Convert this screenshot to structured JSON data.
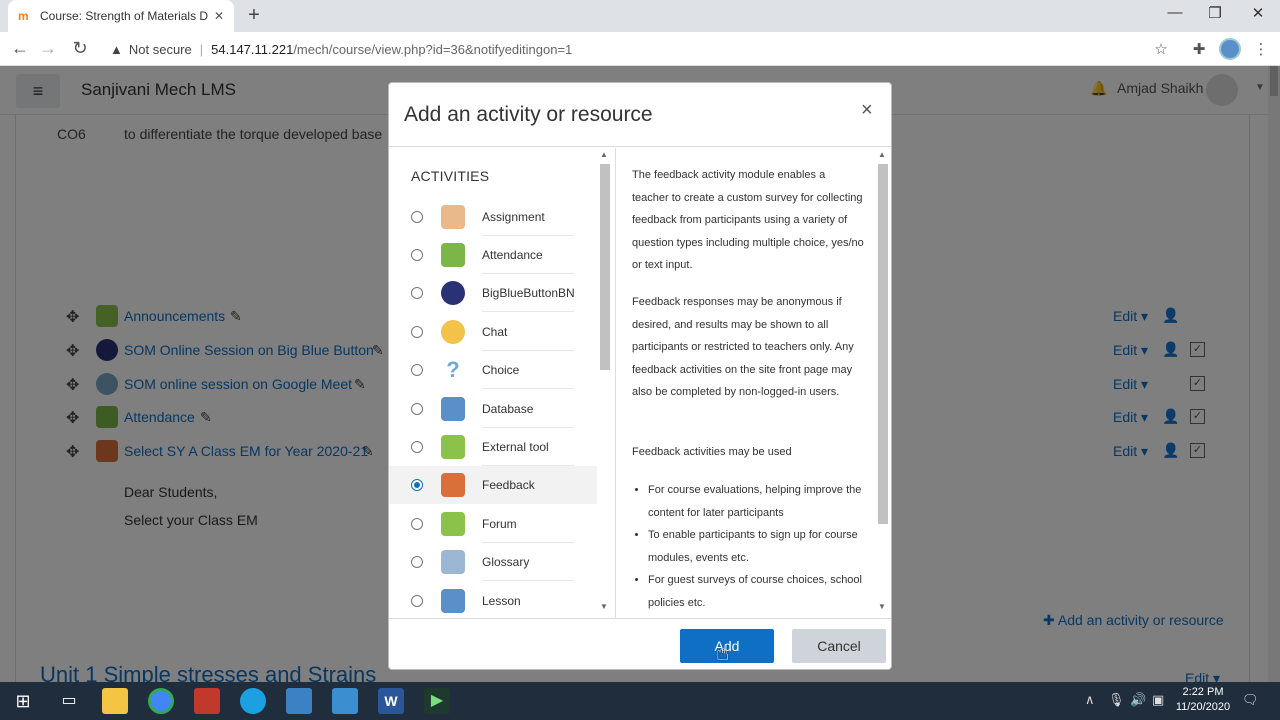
{
  "browser": {
    "tab_title": "Course: Strength of Materials Div",
    "address_not_secure": "Not secure",
    "address_host": "54.147.11.221",
    "address_path": "/mech/course/view.php?id=36&notifyeditingon=1"
  },
  "navbar": {
    "site_name": "Sanjivani Mech LMS",
    "user_name": "Amjad Shaikh"
  },
  "course": {
    "co_code": "CO6",
    "co_text": "to differentiate the torque developed base",
    "activities": [
      {
        "title": "Announcements",
        "edit": "Edit",
        "icon": "forum-icon",
        "has_person": true,
        "has_check": false
      },
      {
        "title": "SOM Online Session on Big Blue Button",
        "edit": "Edit",
        "icon": "bigbluebutton-icon",
        "has_person": true,
        "has_check": true
      },
      {
        "title": "SOM online session on Google Meet",
        "edit": "Edit",
        "icon": "url-globe-icon",
        "has_person": false,
        "has_check": true
      },
      {
        "title": "Attendance",
        "edit": "Edit",
        "icon": "attendance-icon",
        "has_person": true,
        "has_check": true
      },
      {
        "title": "Select SY A Class EM for Year 2020-21",
        "edit": "Edit",
        "icon": "megaphone-icon",
        "has_person": true,
        "has_check": true
      }
    ],
    "summary_line1": "Dear Students,",
    "summary_line2": "Select your Class EM",
    "add_activity_link": "Add an activity or resource",
    "next_section": "Unit 1 Simple stresses and Strains",
    "next_section_edit": "Edit"
  },
  "modal": {
    "title": "Add an activity or resource",
    "close": "×",
    "activities_heading": "ACTIVITIES",
    "options": [
      {
        "label": "Assignment",
        "icon": "assignment-icon",
        "color": "#e9b98a",
        "selected": false
      },
      {
        "label": "Attendance",
        "icon": "attendance-icon",
        "color": "#7ab648",
        "selected": false
      },
      {
        "label": "BigBlueButtonBN",
        "icon": "bigbluebutton-icon",
        "color": "#283274",
        "selected": false
      },
      {
        "label": "Chat",
        "icon": "chat-icon",
        "color": "#f3c24a",
        "selected": false
      },
      {
        "label": "Choice",
        "icon": "choice-icon",
        "color": "#6fa8dc",
        "selected": false
      },
      {
        "label": "Database",
        "icon": "database-icon",
        "color": "#5b8fc9",
        "selected": false
      },
      {
        "label": "External tool",
        "icon": "puzzle-icon",
        "color": "#8bc34a",
        "selected": false
      },
      {
        "label": "Feedback",
        "icon": "megaphone-icon",
        "color": "#d9703a",
        "selected": true
      },
      {
        "label": "Forum",
        "icon": "forum-icon",
        "color": "#8bc34a",
        "selected": false
      },
      {
        "label": "Glossary",
        "icon": "glossary-icon",
        "color": "#9bb7d4",
        "selected": false
      },
      {
        "label": "Lesson",
        "icon": "lesson-icon",
        "color": "#5b8fc9",
        "selected": false
      }
    ],
    "help_p1": "The feedback activity module enables a teacher to create a custom survey for collecting feedback from participants using a variety of question types including multiple choice, yes/no or text input.",
    "help_p2": "Feedback responses may be anonymous if desired, and results may be shown to all participants or restricted to teachers only. Any feedback activities on the site front page may also be completed by non-logged-in users.",
    "help_p3": "Feedback activities may be used",
    "help_list": [
      "For course evaluations, helping improve the content for later participants",
      "To enable participants to sign up for course modules, events etc.",
      "For guest surveys of course choices, school policies etc."
    ],
    "add_button": "Add",
    "cancel_button": "Cancel"
  },
  "taskbar": {
    "time": "2:22 PM",
    "date": "11/20/2020"
  },
  "colors": {
    "link": "#0f6fc5",
    "primary_button": "#0f6fc5",
    "taskbar": "#1f2d3d"
  }
}
